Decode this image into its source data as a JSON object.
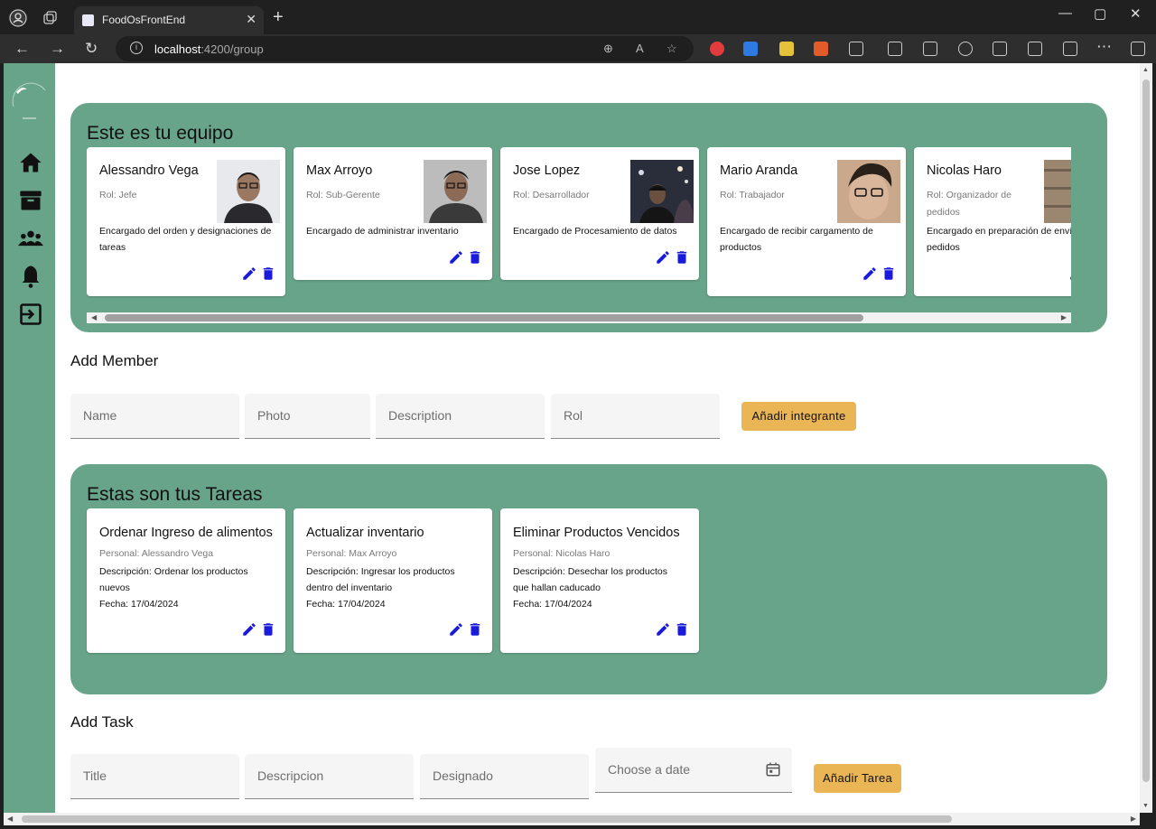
{
  "browser": {
    "tab_title": "FoodOsFrontEnd",
    "url_host": "localhost",
    "url_rest": ":4200/group"
  },
  "team": {
    "title": "Este es tu equipo",
    "members": [
      {
        "name": "Alessandro Vega",
        "role": "Rol: Jefe",
        "description": "Encargado del orden y designaciones de tareas"
      },
      {
        "name": "Max Arroyo",
        "role": "Rol: Sub-Gerente",
        "description": "Encargado de administrar inventario"
      },
      {
        "name": "Jose Lopez",
        "role": "Rol: Desarrollador",
        "description": "Encargado de Procesamiento de datos"
      },
      {
        "name": "Mario Aranda",
        "role": "Rol: Trabajador",
        "description": "Encargado de recibir cargamento de productos"
      },
      {
        "name": "Nicolas Haro",
        "role": "Rol: Organizador de pedidos",
        "description": "Encargado en preparación de envío de pedidos"
      }
    ]
  },
  "add_member": {
    "title": "Add Member",
    "name_placeholder": "Name",
    "photo_placeholder": "Photo",
    "description_placeholder": "Description",
    "rol_placeholder": "Rol",
    "button": "Añadir integrante"
  },
  "tasks": {
    "title": "Estas son tus Tareas",
    "items": [
      {
        "title": "Ordenar Ingreso de alimentos",
        "person": "Personal: Alessandro Vega",
        "description": "Descripción: Ordenar los productos nuevos",
        "date": "Fecha: 17/04/2024"
      },
      {
        "title": "Actualizar inventario",
        "person": "Personal: Max Arroyo",
        "description": "Descripción: Ingresar los productos dentro del inventario",
        "date": "Fecha: 17/04/2024"
      },
      {
        "title": "Eliminar Productos Vencidos",
        "person": "Personal: Nicolas Haro",
        "description": "Descripción: Desechar los productos que hallan caducado",
        "date": "Fecha: 17/04/2024"
      }
    ]
  },
  "add_task": {
    "title": "Add Task",
    "title_placeholder": "Title",
    "description_placeholder": "Descripcion",
    "assigned_placeholder": "Designado",
    "date_placeholder": "Choose a date",
    "button": "Añadir Tarea"
  },
  "colors": {
    "accent": "#68a48a",
    "button": "#eab554",
    "action_icon": "#1a1adb"
  },
  "icons": {
    "sidebar": [
      "home-icon",
      "archive-icon",
      "group-icon",
      "bell-icon",
      "logout-icon"
    ],
    "card_actions": [
      "edit-icon",
      "delete-icon"
    ]
  }
}
